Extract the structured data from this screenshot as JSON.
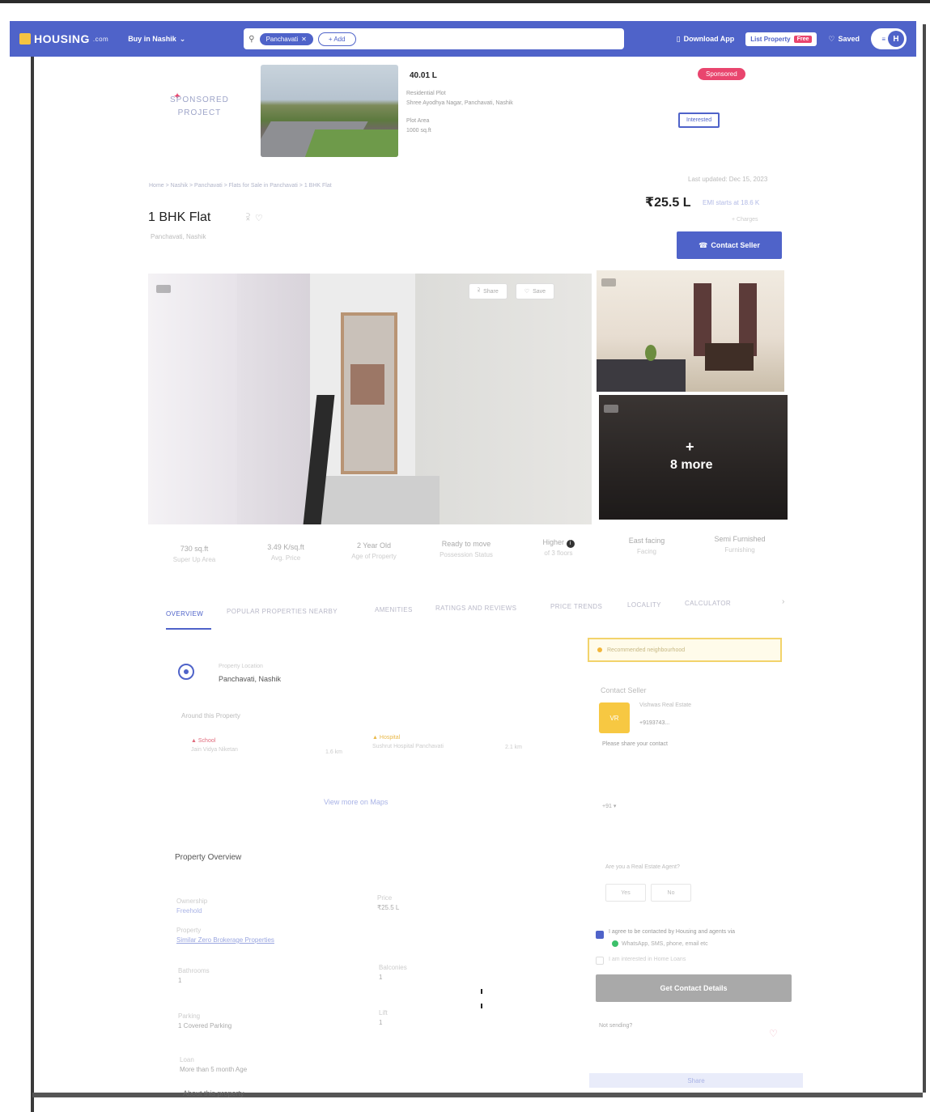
{
  "nav": {
    "logo": "HOUSING",
    "logo_sub": ".com",
    "buy_dropdown": "Buy in Nashik",
    "search_chip": "Panchavati",
    "search_add": "+ Add",
    "download_app": "Download App",
    "post_property": "List Property",
    "free_badge": "Free",
    "saved": "Saved",
    "avatar": "H"
  },
  "sponsored": {
    "label_line1": "SPONSORED",
    "label_line2": "PROJECT",
    "price": "40.01 L",
    "project_name": "Residential Plot",
    "project_location": "Shree Ayodhya Nagar, Panchavati, Nashik",
    "meta_line1": "Plot Area",
    "meta_line2": "1000 sq.ft",
    "badge": "Sponsored",
    "button": "Interested"
  },
  "breadcrumb": "Home > Nashik > Panchavati > Flats for Sale in Panchavati > 1 BHK Flat",
  "updated": "Last updated: Dec 15, 2023",
  "listing": {
    "title": "1 BHK Flat",
    "locality": "Panchavati, Nashik",
    "price": "₹25.5 L",
    "emi": "EMI starts at 18.6 K",
    "price_sub": "+ Charges",
    "contact_button": "Contact Seller"
  },
  "gallery": {
    "share": "Share",
    "save": "Save",
    "more": "8 more",
    "plus": "+"
  },
  "facts": [
    {
      "value": "730 sq.ft",
      "label": "Super Up Area"
    },
    {
      "value": "3.49 K/sq.ft",
      "label": "Avg. Price"
    },
    {
      "value": "2 Year Old",
      "label": "Age of Property"
    },
    {
      "value": "Ready to move",
      "label": "Possession Status"
    },
    {
      "value": "Higher",
      "label": "of 3 floors"
    },
    {
      "value": "East facing",
      "label": "Facing"
    },
    {
      "value": "Semi Furnished",
      "label": "Furnishing"
    }
  ],
  "tabs": [
    "OVERVIEW",
    "POPULAR PROPERTIES NEARBY",
    "AMENITIES",
    "RATINGS AND REVIEWS",
    "PRICE TRENDS",
    "LOCALITY",
    "CALCULATOR"
  ],
  "location": {
    "small_label": "Property Location",
    "name": "Panchavati, Nashik"
  },
  "around": {
    "title": "Around this Property",
    "items": [
      {
        "type": "School",
        "name": "Jain Vidya Niketan",
        "dist": "1.6 km"
      },
      {
        "type": "Hospital",
        "name": "Sushrut Hospital Panchavati",
        "dist": "2.1 km"
      }
    ],
    "view_more": "View more on Maps"
  },
  "overview": {
    "title": "Property Overview",
    "items": [
      {
        "label": "Ownership",
        "value": "Freehold"
      },
      {
        "label": "Price",
        "value": "₹25.5 L"
      },
      {
        "label": "Property",
        "value": "Similar Zero Brokerage Properties"
      },
      {
        "label": "Bathrooms",
        "value": "1"
      },
      {
        "label": "Balconies",
        "value": "1"
      },
      {
        "label": "Parking",
        "value": "1 Covered Parking"
      },
      {
        "label": "Lift",
        "value": "1"
      },
      {
        "label": "Loan",
        "value": "More than 5 month Age"
      }
    ],
    "about": "About this property"
  },
  "seller": {
    "promo": "Recommended neighbourhood",
    "title": "Contact Seller",
    "avatar": "VR",
    "name": "Vishwas Real Estate",
    "phone": "+9193743...",
    "share_prompt": "Please share your contact",
    "code": "+91",
    "agent_q": "Are you a Real Estate Agent?",
    "opt_yes": "Yes",
    "opt_no": "No",
    "agree": "I agree to be contacted by Housing and agents via",
    "whatsapp": "WhatsApp, SMS, phone, email etc",
    "interest": "I am interested in Home Loans",
    "get_button": "Get Contact Details",
    "not_q": "Not sending?",
    "share_bar": "Share"
  }
}
